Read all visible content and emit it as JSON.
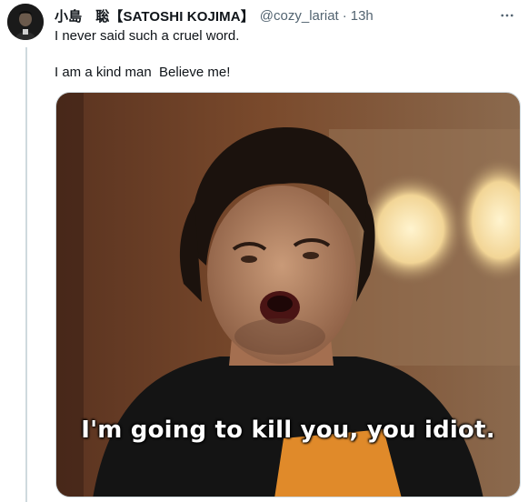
{
  "tweet": {
    "author_name": "小島　聡【SATOSHI KOJIMA】",
    "handle": "@cozy_lariat",
    "separator": "·",
    "timestamp": "13h",
    "text_line1": "I never said such a cruel word.",
    "text_line2": "I am a kind man  Believe me!",
    "media": {
      "caption": "I'm going to kill you, you idiot."
    }
  },
  "icons": {
    "more": "more-options-icon",
    "avatar": "avatar"
  },
  "colors": {
    "text_primary": "#0f1419",
    "text_secondary": "#536471",
    "thread_line": "#cfd9de"
  }
}
